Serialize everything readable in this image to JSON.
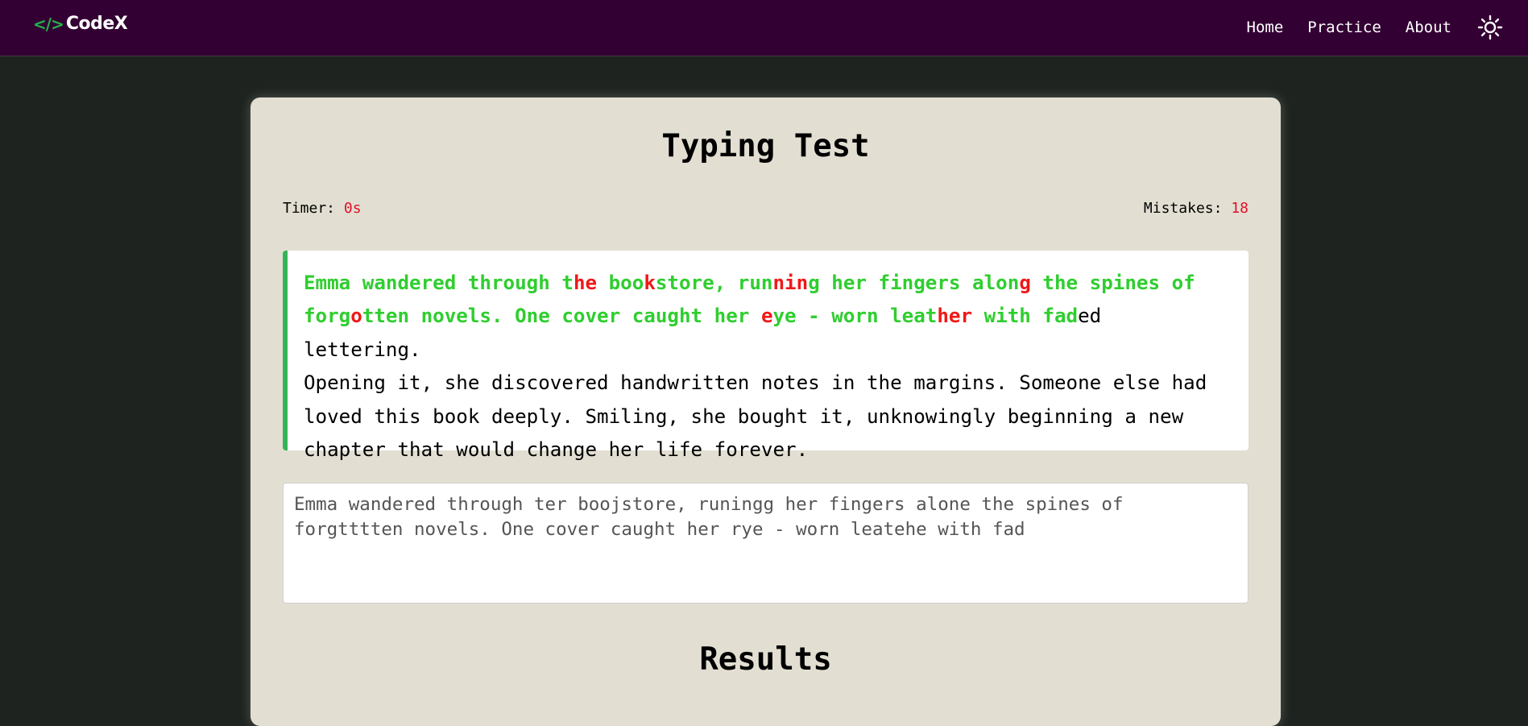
{
  "nav": {
    "brand": "CodeX",
    "brand_icon": "</>",
    "links": [
      "Home",
      "Practice",
      "About"
    ],
    "theme_icon": "sun-icon"
  },
  "test": {
    "title": "Typing Test",
    "timer_label": "Timer:",
    "timer_value": "0s",
    "mistakes_label": "Mistakes:",
    "mistakes_value": "18"
  },
  "quote": {
    "full_text": "Emma wandered through the bookstore, running her fingers along the spines of forgotten novels. One cover caught her eye - worn leather with faded lettering. Opening it, she discovered handwritten notes in the margins. Someone else had loved this book deeply. Smiling, she bought it, unknowingly beginning a new chapter that would change her life forever.",
    "segments": [
      {
        "text": "Emma wandered through t",
        "state": "correct"
      },
      {
        "text": "he",
        "state": "incorrect"
      },
      {
        "text": " boo",
        "state": "correct"
      },
      {
        "text": "k",
        "state": "incorrect"
      },
      {
        "text": "store, run",
        "state": "correct"
      },
      {
        "text": "nin",
        "state": "incorrect"
      },
      {
        "text": "g her fingers alon",
        "state": "correct"
      },
      {
        "text": "g",
        "state": "incorrect"
      },
      {
        "text": " the spines of\nforg",
        "state": "correct"
      },
      {
        "text": "o",
        "state": "incorrect"
      },
      {
        "text": "tten novels. One cover caught her ",
        "state": "correct"
      },
      {
        "text": "e",
        "state": "incorrect"
      },
      {
        "text": "ye - worn leat",
        "state": "correct"
      },
      {
        "text": "her",
        "state": "incorrect"
      },
      {
        "text": " with fad",
        "state": "correct"
      },
      {
        "text": "ed lettering.\nOpening it, she discovered handwritten notes in the margins. Someone else had\nloved this book deeply. Smiling, she bought it, unknowingly beginning a new\nchapter that would change her life forever.",
        "state": "pending"
      }
    ],
    "colors": {
      "correct": "#2fce2f",
      "incorrect": "#f01818",
      "accent_border": "#35b35a"
    }
  },
  "input": {
    "value": "Emma wandered through ter boojstore, runingg her fingers alone the spines of forgtttten novels. One cover caught her rye - worn leatehe with fad"
  },
  "results": {
    "heading": "Results"
  }
}
